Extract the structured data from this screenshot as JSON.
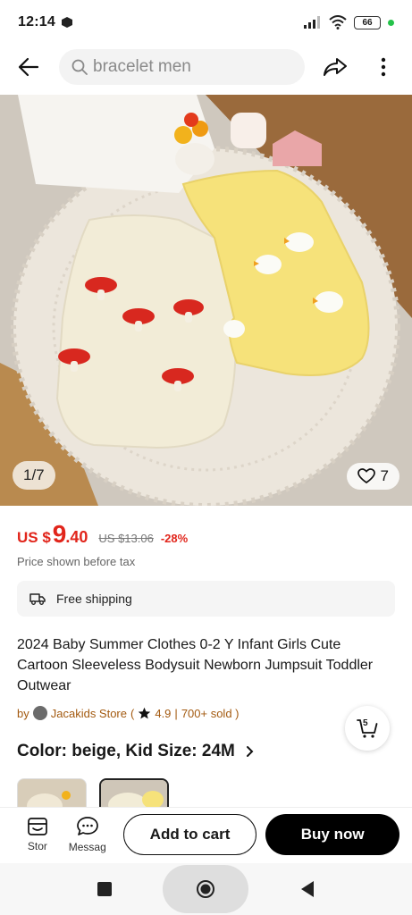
{
  "status_bar": {
    "time": "12:14",
    "battery": "66"
  },
  "search": {
    "placeholder": "bracelet men"
  },
  "gallery": {
    "counter": "1/7",
    "wishlist_count": "7"
  },
  "price": {
    "currency": "US $",
    "integer": "9",
    "decimal": ".40",
    "original": "US $13.06",
    "discount": "-28%",
    "tax_note": "Price shown before tax"
  },
  "shipping": {
    "label": "Free shipping"
  },
  "product": {
    "title": "2024 Baby Summer Clothes 0-2 Y Infant Girls Cute Cartoon Sleeveless Bodysuit Newborn Jumpsuit Toddler Outwear"
  },
  "store": {
    "prefix": "by",
    "name": "Jacakids Store",
    "open": "(",
    "rating": "4.9",
    "separator": "|",
    "sold": "700+ sold )"
  },
  "cart_badge": "5",
  "variant": {
    "label": "Color: beige, Kid Size: 24M"
  },
  "actions": {
    "store_label": "Stor",
    "message_label": "Messag",
    "add_to_cart": "Add to cart",
    "buy_now": "Buy now"
  },
  "colors": {
    "accent_red": "#e1251b",
    "store_brown": "#a35a10",
    "buy_button": "#000000"
  }
}
